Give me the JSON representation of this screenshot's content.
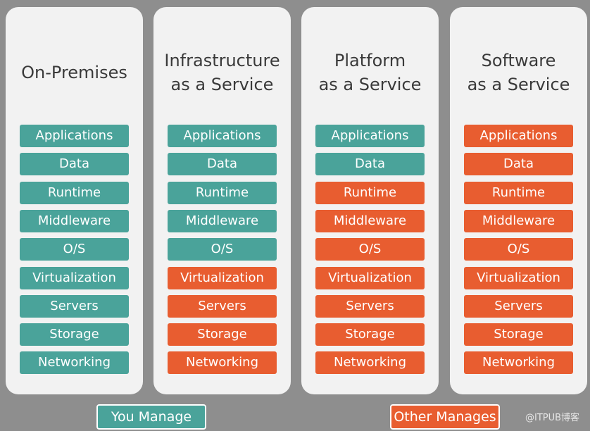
{
  "colors": {
    "you_manage": "#4aa39a",
    "other_manages": "#e85d30"
  },
  "columns": [
    {
      "title": "On-Premises",
      "managed_by": [
        "you",
        "you",
        "you",
        "you",
        "you",
        "you",
        "you",
        "you",
        "you"
      ]
    },
    {
      "title": "Infrastructure\nas a Service",
      "managed_by": [
        "you",
        "you",
        "you",
        "you",
        "you",
        "other",
        "other",
        "other",
        "other"
      ]
    },
    {
      "title": "Platform\nas a Service",
      "managed_by": [
        "you",
        "you",
        "other",
        "other",
        "other",
        "other",
        "other",
        "other",
        "other"
      ]
    },
    {
      "title": "Software\nas a Service",
      "managed_by": [
        "other",
        "other",
        "other",
        "other",
        "other",
        "other",
        "other",
        "other",
        "other"
      ]
    }
  ],
  "layers": [
    "Applications",
    "Data",
    "Runtime",
    "Middleware",
    "O/S",
    "Virtualization",
    "Servers",
    "Storage",
    "Networking"
  ],
  "legend": {
    "you": "You Manage",
    "other": "Other Manages"
  },
  "watermark": "@ITPUB博客"
}
